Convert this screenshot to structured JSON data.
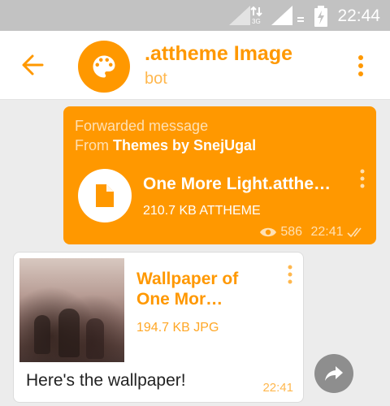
{
  "status_bar": {
    "time": "22:44"
  },
  "header": {
    "title": ".attheme Image",
    "subtitle": "bot",
    "avatar_icon": "palette-icon",
    "accent_color": "#ff9800"
  },
  "messages": {
    "outgoing": {
      "forwarded_label": "Forwarded message",
      "from_prefix": "From",
      "from_name": "Themes by SnejUgal",
      "file_name": "One More Light.atthe…",
      "file_info": "210.7 KB ATTHEME",
      "views": "586",
      "time": "22:41"
    },
    "incoming": {
      "file_title": "Wallpaper of One Mor…",
      "file_info": "194.7 KB JPG",
      "caption": "Here's the wallpaper!",
      "time": "22:41"
    }
  }
}
